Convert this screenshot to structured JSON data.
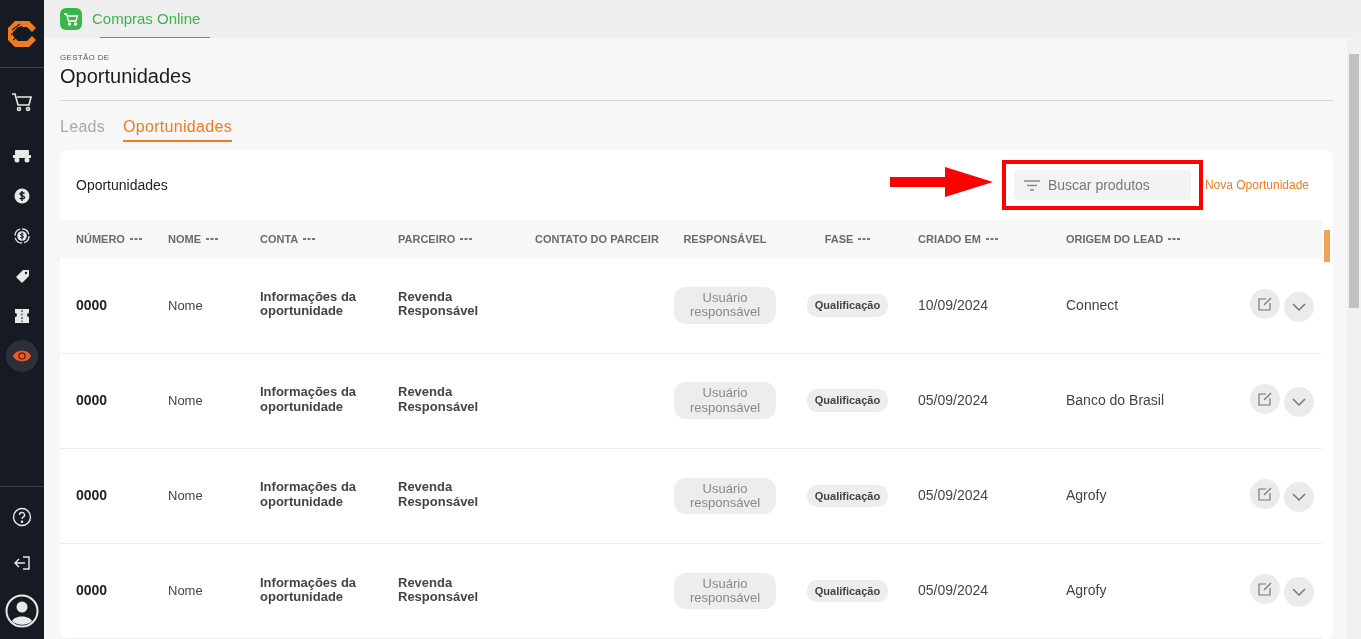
{
  "app_tab": {
    "label": "Compras Online",
    "selected": true
  },
  "sidebar": {
    "items": [
      {
        "kind": "cart",
        "selected": false
      },
      {
        "kind": "tractor",
        "selected": false
      },
      {
        "kind": "dollar",
        "selected": false
      },
      {
        "kind": "coin-cycle",
        "selected": false
      },
      {
        "kind": "tag",
        "selected": false
      },
      {
        "kind": "ticket",
        "selected": false
      },
      {
        "kind": "eye",
        "selected": true
      }
    ],
    "footer": [
      {
        "kind": "help"
      },
      {
        "kind": "logout"
      },
      {
        "kind": "avatar"
      }
    ]
  },
  "header": {
    "eyebrow": "GESTÃO DE",
    "title": "Oportunidades"
  },
  "tabs": [
    {
      "label": "Leads",
      "selected": false
    },
    {
      "label": "Oportunidades",
      "selected": true
    }
  ],
  "card": {
    "title": "Oportunidades",
    "search": {
      "placeholder": "Buscar produtos"
    },
    "new_button": "Nova Oportunidade"
  },
  "table": {
    "columns": [
      {
        "label": "NÚMERO",
        "menu": true
      },
      {
        "label": "NOME",
        "menu": true
      },
      {
        "label": "CONTA",
        "menu": true
      },
      {
        "label": "PARCEIRO",
        "menu": true
      },
      {
        "label": "CONTATO DO PARCEIR",
        "menu": false
      },
      {
        "label": "RESPONSÁVEL",
        "menu": false
      },
      {
        "label": "FASE",
        "menu": true
      },
      {
        "label": "CRIADO EM",
        "menu": true
      },
      {
        "label": "ORIGEM DO LEAD",
        "menu": true
      }
    ],
    "rows": [
      {
        "numero": "0000",
        "nome": "Nome",
        "conta": "Informações da oportunidade",
        "parceiro": "Revenda Responsável",
        "responsavel": "Usuário responsável",
        "fase": "Qualificação",
        "criado_em": "10/09/2024",
        "origem": "Connect"
      },
      {
        "numero": "0000",
        "nome": "Nome",
        "conta": "Informações da oportunidade",
        "parceiro": "Revenda Responsável",
        "responsavel": "Usuário responsável",
        "fase": "Qualificação",
        "criado_em": "05/09/2024",
        "origem": "Banco do Brasil"
      },
      {
        "numero": "0000",
        "nome": "Nome",
        "conta": "Informações da oportunidade",
        "parceiro": "Revenda Responsável",
        "responsavel": "Usuário responsável",
        "fase": "Qualificação",
        "criado_em": "05/09/2024",
        "origem": "Agrofy"
      },
      {
        "numero": "0000",
        "nome": "Nome",
        "conta": "Informações da oportunidade",
        "parceiro": "Revenda Responsável",
        "responsavel": "Usuário responsável",
        "fase": "Qualificação",
        "criado_em": "05/09/2024",
        "origem": "Agrofy"
      }
    ]
  }
}
